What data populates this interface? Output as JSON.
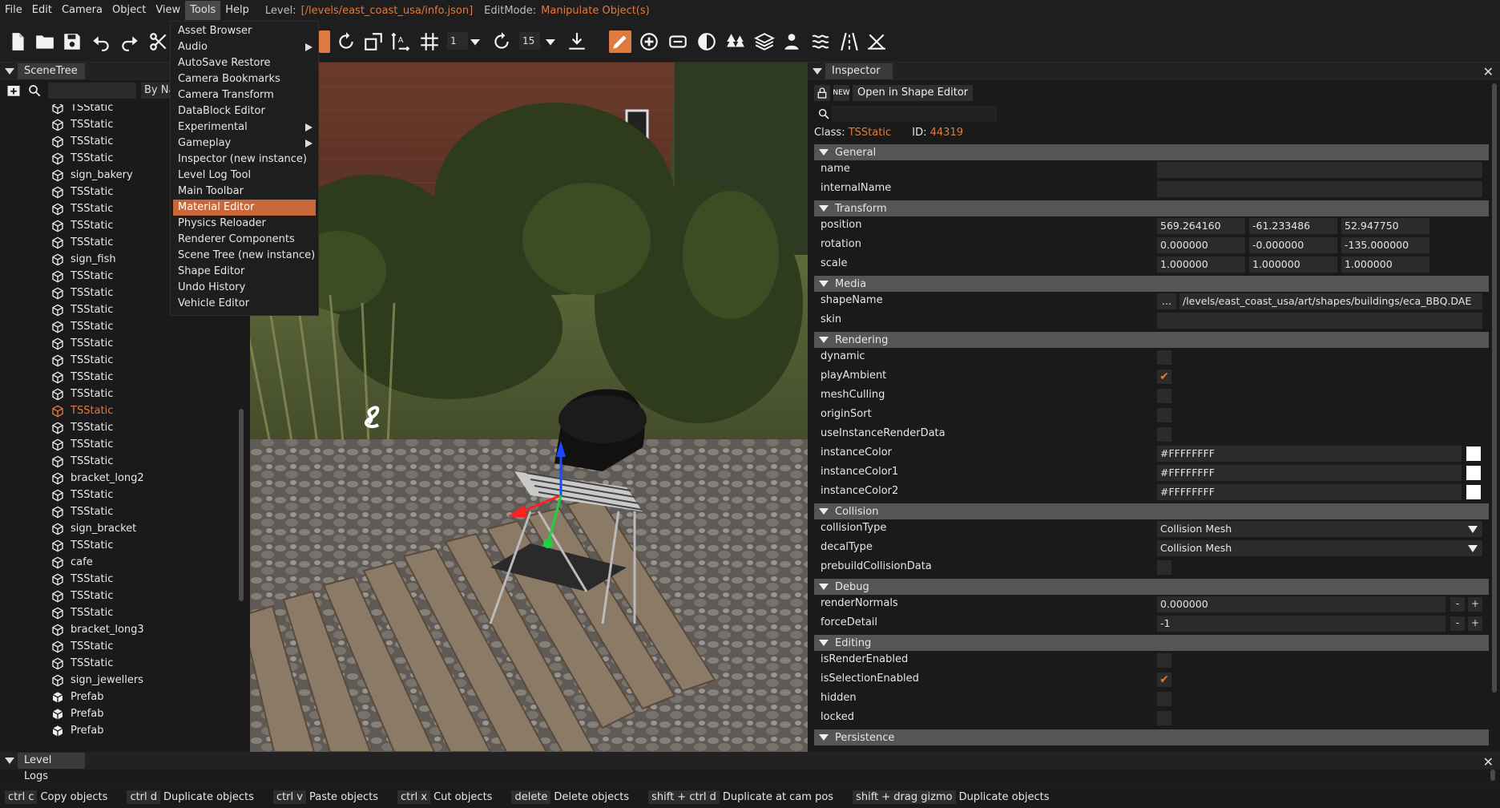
{
  "menubar": {
    "items": [
      "File",
      "Edit",
      "Camera",
      "Object",
      "View",
      "Tools",
      "Help"
    ],
    "level_label": "Level:",
    "level_value": "[/levels/east_coast_usa/info.json]",
    "editmode_label": "EditMode:",
    "editmode_value": "Manipulate Object(s)"
  },
  "toolbar": {
    "snap_value": "1",
    "rotate_snap_value": "15"
  },
  "tools_menu": {
    "items": [
      {
        "label": "Asset Browser",
        "submenu": false
      },
      {
        "label": "Audio",
        "submenu": true
      },
      {
        "label": "AutoSave Restore",
        "submenu": false
      },
      {
        "label": "Camera Bookmarks",
        "submenu": false
      },
      {
        "label": "Camera Transform",
        "submenu": false
      },
      {
        "label": "DataBlock Editor",
        "submenu": false
      },
      {
        "label": "Experimental",
        "submenu": true
      },
      {
        "label": "Gameplay",
        "submenu": true
      },
      {
        "label": "Inspector (new instance)",
        "submenu": false
      },
      {
        "label": "Level Log Tool",
        "submenu": false
      },
      {
        "label": "Main Toolbar",
        "submenu": false
      },
      {
        "label": "Material Editor",
        "submenu": false,
        "highlighted": true
      },
      {
        "label": "Physics Reloader",
        "submenu": false
      },
      {
        "label": "Renderer Components",
        "submenu": false
      },
      {
        "label": "Scene Tree (new instance)",
        "submenu": false
      },
      {
        "label": "Shape Editor",
        "submenu": false
      },
      {
        "label": "Undo History",
        "submenu": false
      },
      {
        "label": "Vehicle Editor",
        "submenu": false
      }
    ]
  },
  "scenetree": {
    "title": "SceneTree",
    "filter_label": "By Name",
    "items": [
      {
        "label": "TSStatic",
        "icon": "cube-icon"
      },
      {
        "label": "TSStatic",
        "icon": "cube-icon"
      },
      {
        "label": "TSStatic",
        "icon": "cube-icon"
      },
      {
        "label": "TSStatic",
        "icon": "cube-icon"
      },
      {
        "label": "sign_bakery",
        "icon": "cube-icon"
      },
      {
        "label": "TSStatic",
        "icon": "cube-icon"
      },
      {
        "label": "TSStatic",
        "icon": "cube-icon"
      },
      {
        "label": "TSStatic",
        "icon": "cube-icon"
      },
      {
        "label": "TSStatic",
        "icon": "cube-icon"
      },
      {
        "label": "sign_fish",
        "icon": "cube-icon"
      },
      {
        "label": "TSStatic",
        "icon": "cube-icon"
      },
      {
        "label": "TSStatic",
        "icon": "cube-icon"
      },
      {
        "label": "TSStatic",
        "icon": "cube-icon"
      },
      {
        "label": "TSStatic",
        "icon": "cube-icon"
      },
      {
        "label": "TSStatic",
        "icon": "cube-icon"
      },
      {
        "label": "TSStatic",
        "icon": "cube-icon"
      },
      {
        "label": "TSStatic",
        "icon": "cube-icon"
      },
      {
        "label": "TSStatic",
        "icon": "cube-icon"
      },
      {
        "label": "TSStatic",
        "icon": "cube-icon",
        "selected": true
      },
      {
        "label": "TSStatic",
        "icon": "cube-icon"
      },
      {
        "label": "TSStatic",
        "icon": "cube-icon"
      },
      {
        "label": "TSStatic",
        "icon": "cube-icon"
      },
      {
        "label": "bracket_long2",
        "icon": "cube-icon"
      },
      {
        "label": "TSStatic",
        "icon": "cube-icon"
      },
      {
        "label": "TSStatic",
        "icon": "cube-icon"
      },
      {
        "label": "sign_bracket",
        "icon": "cube-icon"
      },
      {
        "label": "TSStatic",
        "icon": "cube-icon"
      },
      {
        "label": "cafe",
        "icon": "cube-icon"
      },
      {
        "label": "TSStatic",
        "icon": "cube-icon"
      },
      {
        "label": "TSStatic",
        "icon": "cube-icon"
      },
      {
        "label": "TSStatic",
        "icon": "cube-icon"
      },
      {
        "label": "bracket_long3",
        "icon": "cube-icon"
      },
      {
        "label": "TSStatic",
        "icon": "cube-icon"
      },
      {
        "label": "TSStatic",
        "icon": "cube-icon"
      },
      {
        "label": "sign_jewellers",
        "icon": "cube-icon"
      },
      {
        "label": "Prefab",
        "icon": "prefab-icon"
      },
      {
        "label": "Prefab",
        "icon": "prefab-icon"
      },
      {
        "label": "Prefab",
        "icon": "prefab-icon"
      }
    ]
  },
  "inspector": {
    "title": "Inspector",
    "open_shape_editor": "Open in Shape Editor",
    "class_label": "Class:",
    "class_value": "TSStatic",
    "id_label": "ID:",
    "id_value": "44319",
    "sections": [
      {
        "title": "General",
        "props": [
          {
            "name": "name",
            "type": "text",
            "value": ""
          },
          {
            "name": "internalName",
            "type": "text",
            "value": ""
          }
        ]
      },
      {
        "title": "Transform",
        "props": [
          {
            "name": "position",
            "type": "vec3",
            "values": [
              "569.264160",
              "-61.233486",
              "52.947750"
            ]
          },
          {
            "name": "rotation",
            "type": "vec3",
            "values": [
              "0.000000",
              "-0.000000",
              "-135.000000"
            ]
          },
          {
            "name": "scale",
            "type": "vec3",
            "values": [
              "1.000000",
              "1.000000",
              "1.000000"
            ]
          }
        ]
      },
      {
        "title": "Media",
        "props": [
          {
            "name": "shapeName",
            "type": "file",
            "button": "...",
            "value": "/levels/east_coast_usa/art/shapes/buildings/eca_BBQ.DAE"
          },
          {
            "name": "skin",
            "type": "text",
            "value": ""
          }
        ]
      },
      {
        "title": "Rendering",
        "props": [
          {
            "name": "dynamic",
            "type": "check",
            "checked": false
          },
          {
            "name": "playAmbient",
            "type": "check",
            "checked": true
          },
          {
            "name": "meshCulling",
            "type": "check",
            "checked": false
          },
          {
            "name": "originSort",
            "type": "check",
            "checked": false
          },
          {
            "name": "useInstanceRenderData",
            "type": "check",
            "checked": false
          },
          {
            "name": "instanceColor",
            "type": "color",
            "value": "#FFFFFFFF"
          },
          {
            "name": "instanceColor1",
            "type": "color",
            "value": "#FFFFFFFF"
          },
          {
            "name": "instanceColor2",
            "type": "color",
            "value": "#FFFFFFFF"
          }
        ]
      },
      {
        "title": "Collision",
        "props": [
          {
            "name": "collisionType",
            "type": "select",
            "value": "Collision Mesh"
          },
          {
            "name": "decalType",
            "type": "select",
            "value": "Collision Mesh"
          },
          {
            "name": "prebuildCollisionData",
            "type": "check",
            "checked": false
          }
        ]
      },
      {
        "title": "Debug",
        "props": [
          {
            "name": "renderNormals",
            "type": "stepper",
            "value": "0.000000",
            "minus": "-",
            "plus": "+"
          },
          {
            "name": "forceDetail",
            "type": "stepper",
            "value": "-1",
            "minus": "-",
            "plus": "+"
          }
        ]
      },
      {
        "title": "Editing",
        "props": [
          {
            "name": "isRenderEnabled",
            "type": "check",
            "checked": false
          },
          {
            "name": "isSelectionEnabled",
            "type": "check",
            "checked": true
          },
          {
            "name": "hidden",
            "type": "check",
            "checked": false
          },
          {
            "name": "locked",
            "type": "check",
            "checked": false
          }
        ]
      },
      {
        "title": "Persistence",
        "props": []
      }
    ]
  },
  "level_logs": {
    "title": "Level Logs"
  },
  "statusbar": {
    "hotkeys": [
      {
        "key": "ctrl c",
        "desc": "Copy objects"
      },
      {
        "key": "ctrl d",
        "desc": "Duplicate objects"
      },
      {
        "key": "ctrl v",
        "desc": "Paste objects"
      },
      {
        "key": "ctrl x",
        "desc": "Cut objects"
      },
      {
        "key": "delete",
        "desc": "Delete objects"
      },
      {
        "key": "shift + ctrl d",
        "desc": "Duplicate at cam pos"
      },
      {
        "key": "shift + drag gizmo",
        "desc": "Duplicate objects"
      }
    ]
  },
  "colors": {
    "accent": "#E07A3E",
    "panel_bg": "#1A1A1A",
    "section_bg": "#555555"
  }
}
